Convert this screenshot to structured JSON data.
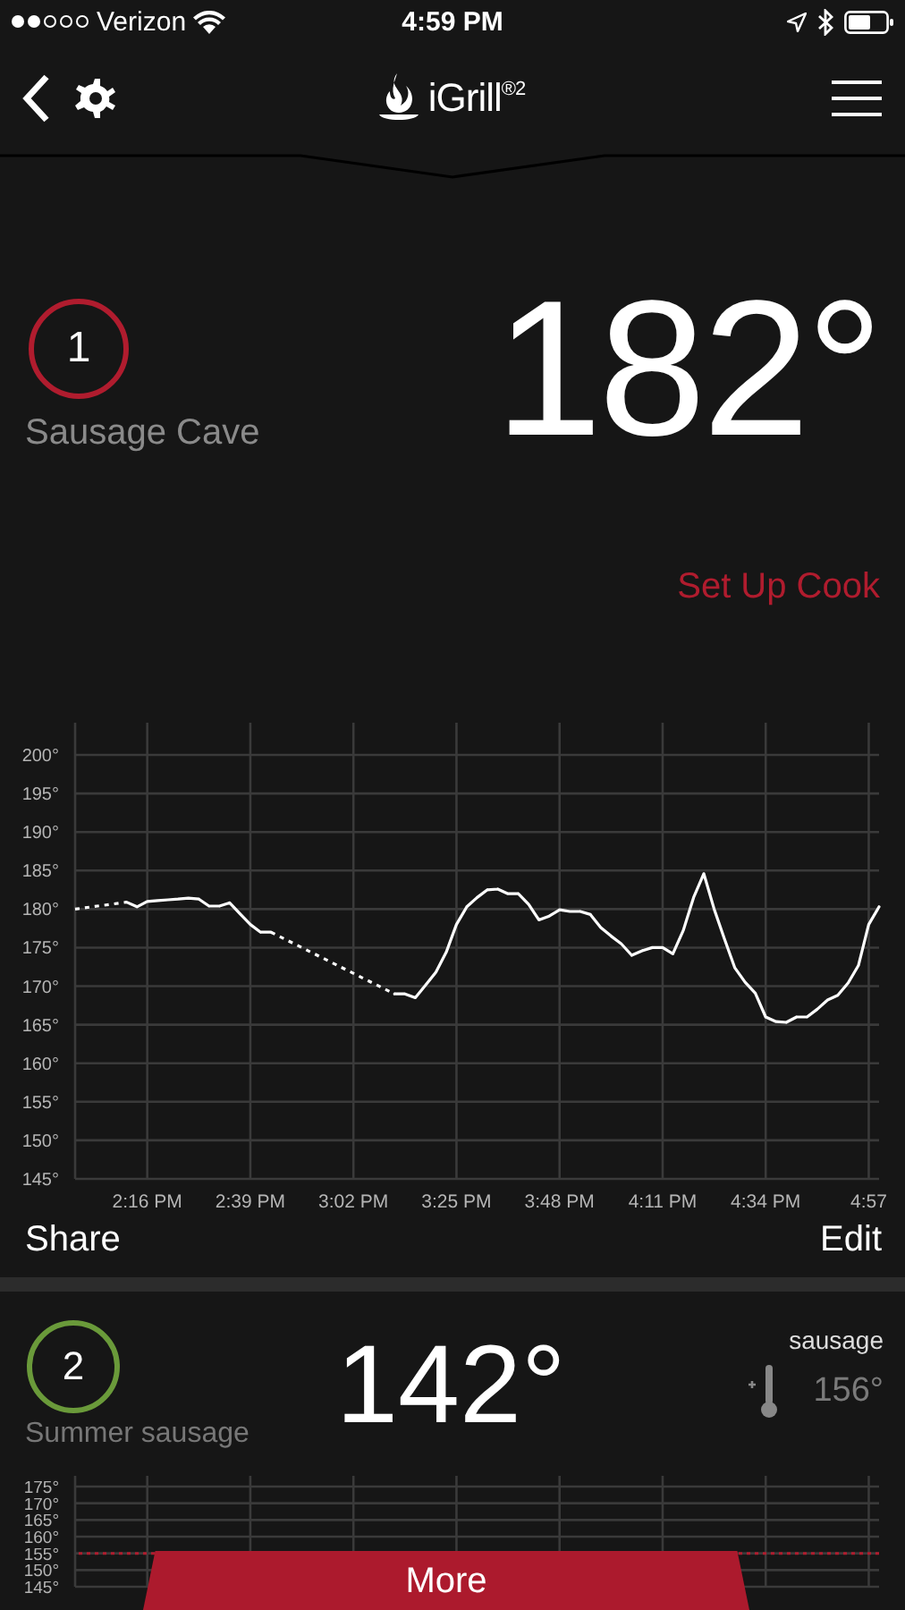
{
  "status_bar": {
    "carrier": "Verizon",
    "time": "4:59 PM"
  },
  "nav": {
    "logo": "iGrill$^{®2}$"
  },
  "probe_panel": {
    "number": "1",
    "color": "#b01c2e",
    "name": "Sausage Cave",
    "temperature": "182°",
    "action": "Set Up Cook",
    "chart_data": {
      "type": "line",
      "grid": true,
      "ylim": [
        145,
        200
      ],
      "categories": [
        null,
        null,
        null,
        null,
        null,
        null,
        null,
        "2:16 PM",
        null,
        null,
        null,
        null,
        null,
        null,
        null,
        null,
        null,
        "2:39 PM",
        null,
        null,
        null,
        null,
        null,
        null,
        null,
        null,
        null,
        "3:02 PM",
        null,
        null,
        null,
        null,
        null,
        null,
        null,
        null,
        null,
        "3:25 PM",
        null,
        null,
        null,
        null,
        null,
        null,
        null,
        null,
        null,
        "3:48 PM",
        null,
        null,
        null,
        null,
        null,
        null,
        null,
        null,
        null,
        "4:11 PM",
        null,
        null,
        null,
        null,
        null,
        null,
        null,
        null,
        null,
        "4:34 PM",
        null,
        null,
        null,
        null,
        null,
        null,
        null,
        null,
        null,
        "4:57",
        null
      ],
      "series": [
        {
          "color": "#ffffff",
          "values": [
            180,
            null,
            null,
            null,
            null,
            180.9,
            180.3,
            181,
            181.1,
            181.2,
            181.3,
            181.4,
            181.3,
            180.4,
            180.4,
            180.8,
            179.4,
            178,
            177,
            177,
            null,
            null,
            null,
            null,
            null,
            null,
            null,
            null,
            null,
            null,
            null,
            169,
            169,
            168.5,
            170.1,
            171.8,
            174.4,
            178,
            180.3,
            181.5,
            182.5,
            182.6,
            182,
            182,
            180.6,
            178.6,
            179.1,
            179.9,
            179.7,
            179.7,
            179.3,
            177.6,
            176.5,
            175.5,
            174,
            174.6,
            175,
            175,
            174.2,
            177.2,
            181.5,
            184.6,
            180,
            176.1,
            172.4,
            170.5,
            169.1,
            166,
            165.4,
            165.3,
            166,
            166,
            167,
            168.2,
            168.8,
            170.4,
            172.7,
            178,
            180.3
          ]
        }
      ],
      "yticks": [
        {
          "value": 200,
          "label": "200°"
        },
        {
          "value": 195,
          "label": "195°"
        },
        {
          "value": 190,
          "label": "190°"
        },
        {
          "value": 185,
          "label": "185°"
        },
        {
          "value": 180,
          "label": "180°"
        },
        {
          "value": 175,
          "label": "175°"
        },
        {
          "value": 170,
          "label": "170°"
        },
        {
          "value": 165,
          "label": "165°"
        },
        {
          "value": 160,
          "label": "160°"
        },
        {
          "value": 155,
          "label": "155°"
        },
        {
          "value": 150,
          "label": "150°"
        },
        {
          "value": 145,
          "label": "145°"
        }
      ]
    },
    "share": "Share",
    "edit": "Edit"
  },
  "probe_card": {
    "number": "2",
    "color": "#6a9a3a",
    "name": "Summer sausage",
    "temperature": "142°",
    "preset": "sausage",
    "target": "156°",
    "chart_data": {
      "type": "line",
      "grid": true,
      "ylim": [
        145,
        175
      ],
      "categories": [
        null,
        null,
        null,
        null,
        null,
        null,
        null,
        null,
        null
      ],
      "yticks": [
        {
          "value": 175,
          "label": "175°"
        },
        {
          "value": 170,
          "label": "170°"
        },
        {
          "value": 165,
          "label": "165°"
        },
        {
          "value": 160,
          "label": "160°"
        },
        {
          "value": 155,
          "label": "155°"
        },
        {
          "value": 150,
          "label": "150°"
        },
        {
          "value": 145,
          "label": "145°"
        }
      ],
      "ref_lines": [
        {
          "axis": "y",
          "value": 155
        }
      ]
    }
  },
  "more_button": "More"
}
